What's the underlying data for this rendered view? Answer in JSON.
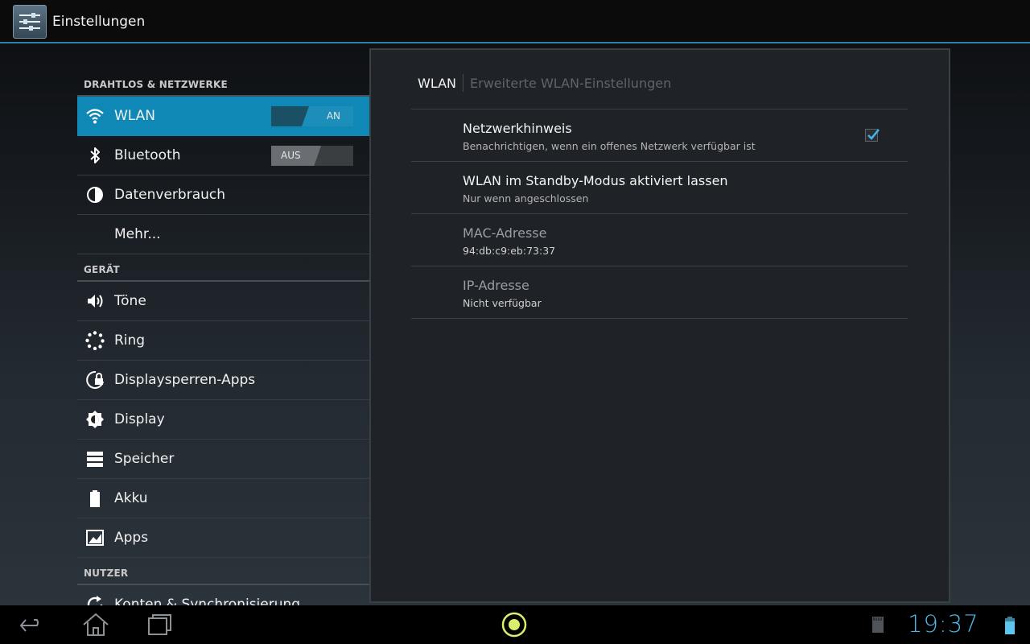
{
  "actionbar": {
    "title": "Einstellungen"
  },
  "sidebar": {
    "sections": [
      {
        "header": "DRAHTLOS & NETZWERKE",
        "items": [
          {
            "label": "WLAN",
            "icon": "wifi-icon",
            "toggle": "AN",
            "selected": true
          },
          {
            "label": "Bluetooth",
            "icon": "bluetooth-icon",
            "toggle": "AUS"
          },
          {
            "label": "Datenverbrauch",
            "icon": "data-usage-icon"
          },
          {
            "label": "Mehr..."
          }
        ]
      },
      {
        "header": "GERÄT",
        "items": [
          {
            "label": "Töne",
            "icon": "sound-icon"
          },
          {
            "label": "Ring",
            "icon": "ring-icon"
          },
          {
            "label": "Displaysperren-Apps",
            "icon": "lock-apps-icon"
          },
          {
            "label": "Display",
            "icon": "display-icon"
          },
          {
            "label": "Speicher",
            "icon": "storage-icon"
          },
          {
            "label": "Akku",
            "icon": "battery-icon"
          },
          {
            "label": "Apps",
            "icon": "apps-icon"
          }
        ]
      },
      {
        "header": "NUTZER",
        "items": [
          {
            "label": "Konten & Synchronisierung",
            "icon": "sync-icon"
          }
        ]
      }
    ]
  },
  "detail": {
    "breadcrumb": {
      "current": "WLAN",
      "next": "Erweiterte WLAN-Einstellungen"
    },
    "prefs": [
      {
        "title": "Netzwerkhinweis",
        "summary": "Benachrichtigen, wenn ein offenes Netzwerk verfügbar ist",
        "checked": true
      },
      {
        "title": "WLAN im Standby-Modus aktiviert lassen",
        "summary": "Nur wenn angeschlossen"
      },
      {
        "title": "MAC-Adresse",
        "summary": "94:db:c9:eb:73:37"
      },
      {
        "title": "IP-Adresse",
        "summary": "Nicht verfügbar"
      }
    ]
  },
  "statusbar": {
    "time": "19:37"
  },
  "colors": {
    "accent": "#0f88b5",
    "clock": "#4fb5e6",
    "background": "#1f2226"
  }
}
